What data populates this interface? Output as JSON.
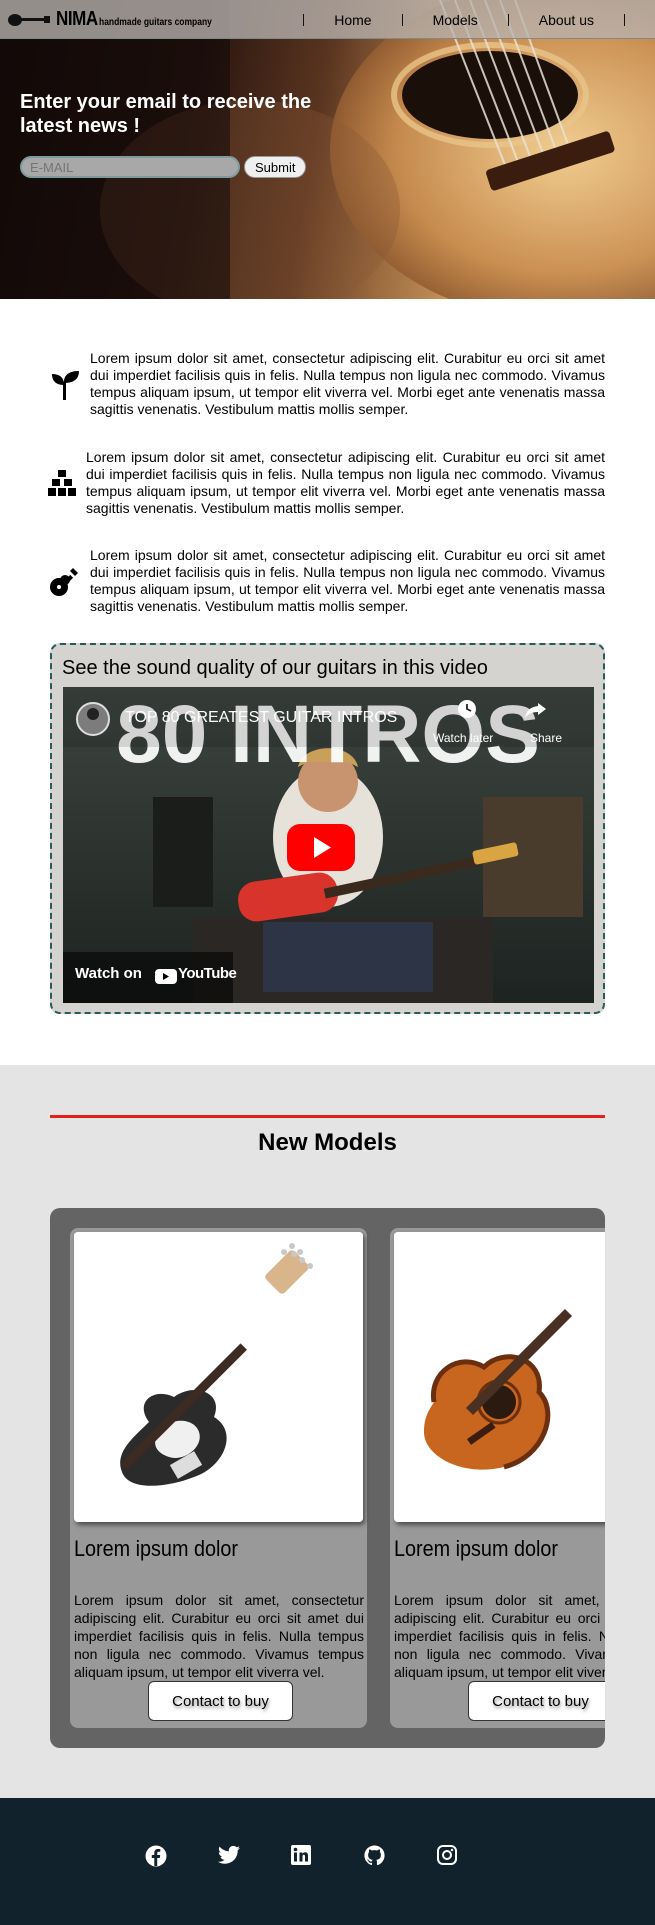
{
  "header": {
    "brand": "NIMA",
    "tagline": "handmade guitars company",
    "nav": [
      {
        "label": "Home"
      },
      {
        "label": "Models"
      },
      {
        "label": "About us"
      }
    ]
  },
  "hero": {
    "heading": "Enter your email to receive the latest news !",
    "email_placeholder": "E-MAIL",
    "submit_label": "Submit"
  },
  "features": [
    {
      "icon": "seedling-icon",
      "text": "Lorem ipsum dolor sit amet, consectetur adipiscing elit. Curabitur eu orci sit amet dui imperdiet facilisis quis in felis. Nulla tempus non ligula nec commodo. Vivamus tempus aliquam ipsum, ut tempor elit viverra vel. Morbi eget ante venenatis massa sagittis venenatis. Vestibulum mattis mollis semper."
    },
    {
      "icon": "cubes-stacked-icon",
      "text": "Lorem ipsum dolor sit amet, consectetur adipiscing elit. Curabitur eu orci sit amet dui imperdiet facilisis quis in felis. Nulla tempus non ligula nec commodo. Vivamus tempus aliquam ipsum, ut tempor elit viverra vel. Morbi eget ante venenatis massa sagittis venenatis. Vestibulum mattis mollis semper."
    },
    {
      "icon": "guitar-icon",
      "text": "Lorem ipsum dolor sit amet, consectetur adipiscing elit. Curabitur eu orci sit amet dui imperdiet facilisis quis in felis. Nulla tempus non ligula nec commodo. Vivamus tempus aliquam ipsum, ut tempor elit viverra vel. Morbi eget ante venenatis massa sagittis venenatis. Vestibulum mattis mollis semper."
    }
  ],
  "video": {
    "heading": "See the sound quality of our guitars in this video",
    "yt_title": "TOP 80 GREATEST GUITAR INTROS",
    "watch_later": "Watch later",
    "share": "Share",
    "thumbnail_text": "80 INTROS",
    "watch_on": "Watch on",
    "youtube": "YouTube"
  },
  "models": {
    "heading": "New Models",
    "cards": [
      {
        "image": "electric-guitar",
        "title": "Lorem ipsum dolor",
        "text": "Lorem ipsum dolor sit amet, consectetur adipiscing elit. Curabitur eu orci sit amet dui imperdiet facilisis quis in felis. Nulla tempus non ligula nec commodo. Vivamus tempus aliquam ipsum, ut tempor elit viverra vel.",
        "button": "Contact to buy"
      },
      {
        "image": "acoustic-guitar",
        "title": "Lorem ipsum dolor",
        "text": "Lorem ipsum dolor sit amet, consectetur adipiscing elit. Curabitur eu orci sit amet dui imperdiet facilisis quis in felis. Nulla tempus non ligula nec commodo. Vivamus tempus aliquam ipsum, ut tempor elit viverra vel.",
        "button": "Contact to buy"
      }
    ]
  },
  "footer": {
    "socials": [
      "facebook-icon",
      "twitter-icon",
      "linkedin-icon",
      "github-icon",
      "instagram-icon"
    ]
  },
  "colors": {
    "accent_red": "#e5201b",
    "footer_bg": "#11222c",
    "dashed_border": "#275c57"
  }
}
